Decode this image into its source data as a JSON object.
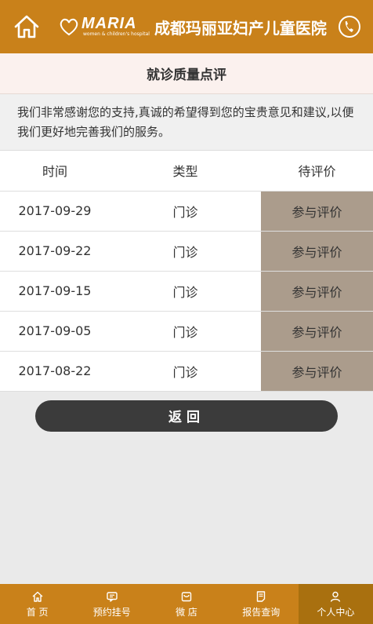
{
  "header": {
    "logo_en": "MARIA",
    "logo_sub": "women & children's hospital",
    "logo_cn": "成都玛丽亚妇产儿童医院"
  },
  "page": {
    "title": "就诊质量点评",
    "intro": "我们非常感谢您的支持,真诚的希望得到您的宝贵意见和建议,以便我们更好地完善我们的服务。"
  },
  "table": {
    "headers": [
      "时间",
      "类型",
      "待评价"
    ],
    "rows": [
      {
        "date": "2017-09-29",
        "type": "门诊",
        "action": "参与评价"
      },
      {
        "date": "2017-09-22",
        "type": "门诊",
        "action": "参与评价"
      },
      {
        "date": "2017-09-15",
        "type": "门诊",
        "action": "参与评价"
      },
      {
        "date": "2017-09-05",
        "type": "门诊",
        "action": "参与评价"
      },
      {
        "date": "2017-08-22",
        "type": "门诊",
        "action": "参与评价"
      }
    ]
  },
  "back_label": "返回",
  "tabbar": {
    "items": [
      {
        "label": "首 页",
        "icon": "home-icon"
      },
      {
        "label": "预约挂号",
        "icon": "message-icon"
      },
      {
        "label": "微 店",
        "icon": "shop-icon"
      },
      {
        "label": "报告查询",
        "icon": "report-icon"
      },
      {
        "label": "个人中心",
        "icon": "user-icon"
      }
    ]
  },
  "colors": {
    "brand": "#c9811a",
    "brand_dark": "#a9700f",
    "action": "#ab9c8c",
    "button_dark": "#3b3b3b"
  }
}
